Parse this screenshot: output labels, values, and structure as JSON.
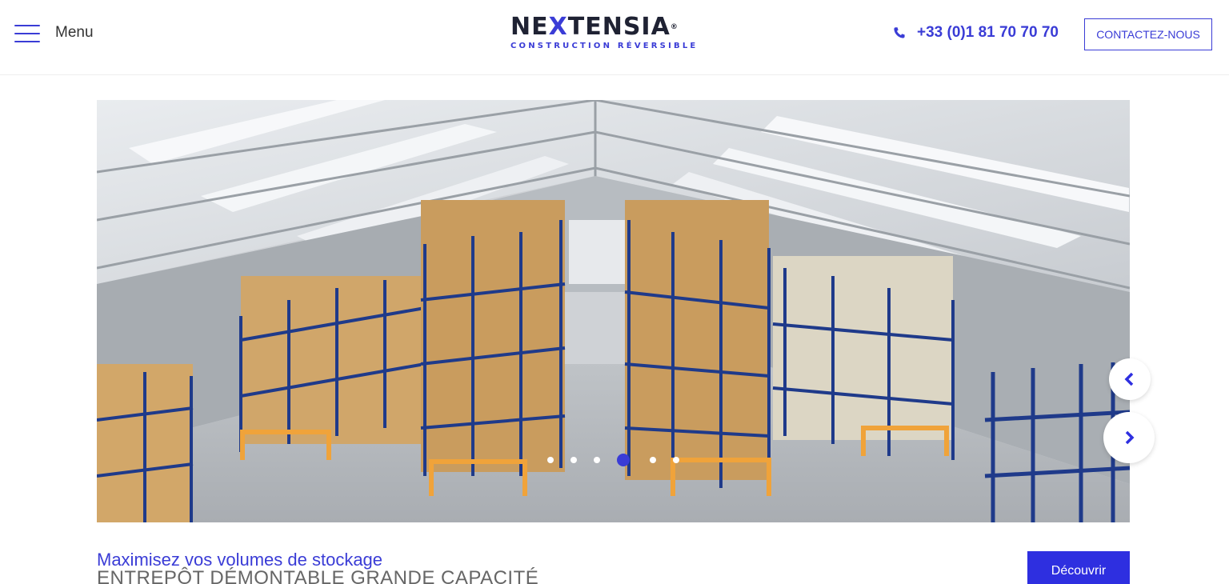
{
  "header": {
    "menu_label": "Menu",
    "logo_text_1": "NE",
    "logo_text_x": "X",
    "logo_text_2": "TENSIA",
    "logo_registered": "®",
    "logo_subtitle": "CONSTRUCTION RÉVERSIBLE",
    "phone": "+33 (0)1 81 70 70 70",
    "contact_button": "CONTACTEZ-NOUS"
  },
  "slider": {
    "slide_count": 6,
    "active_slide": 4,
    "prev_icon": "chevron-left-icon",
    "next_icon": "chevron-right-icon"
  },
  "caption": {
    "title": "Maximisez vos volumes de stockage",
    "subtitle": "ENTREPÔT DÉMONTABLE GRANDE CAPACITÉ",
    "cta_label": "Découvrir"
  },
  "colors": {
    "accent": "#3a3cd6",
    "cta": "#2e2fe0",
    "text": "#333333"
  }
}
